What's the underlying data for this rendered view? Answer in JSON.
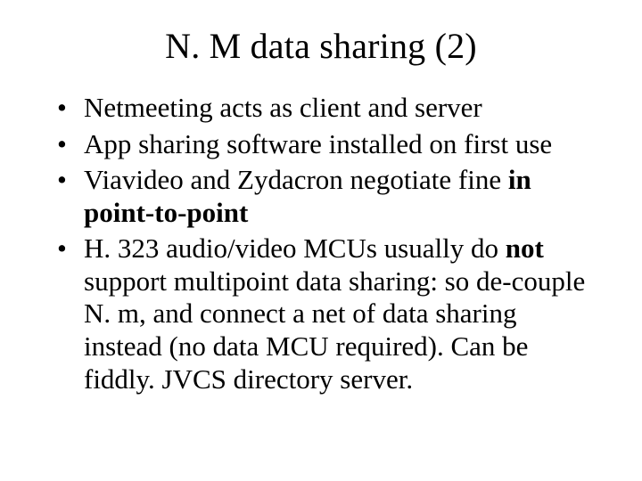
{
  "title": "N. M data sharing (2)",
  "bullets": [
    {
      "plain": "Netmeeting acts as client and server"
    },
    {
      "plain": "App sharing software installed on first use"
    },
    {
      "prefix": "Viavideo and Zydacron negotiate fine ",
      "bold": "in point-to-point"
    },
    {
      "mid_prefix": "H. 323 audio/video MCUs usually do ",
      "mid_bold": "not",
      "mid_suffix": " support multipoint data sharing: so de-couple N. m, and connect a net of data sharing instead (no data MCU required). Can be fiddly.  JVCS directory server."
    }
  ]
}
